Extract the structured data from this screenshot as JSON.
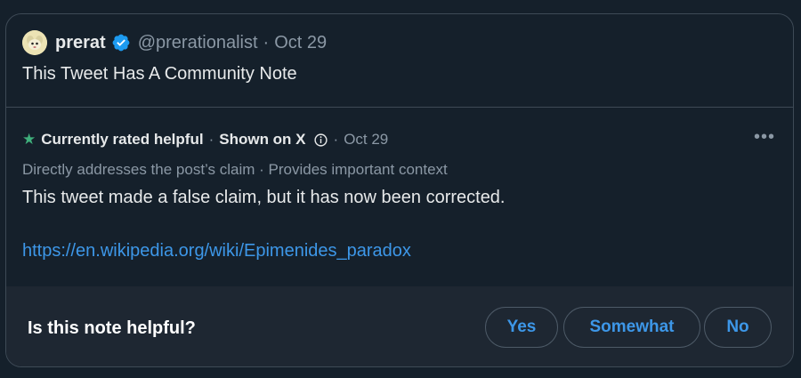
{
  "tweet": {
    "author_name": "prerat",
    "author_handle": "@prerationalist",
    "separator": "·",
    "date": "Oct 29",
    "text": "This Tweet Has A Community Note"
  },
  "note": {
    "status_label": "Currently rated helpful",
    "separator": "·",
    "shown_label": "Shown on X",
    "date": "Oct 29",
    "reasons": "Directly addresses the post’s claim · Provides important context",
    "text": "This tweet made a false claim, but it has now been corrected.",
    "link": "https://en.wikipedia.org/wiki/Epimenides_paradox",
    "more_label": "•••"
  },
  "rating": {
    "question": "Is this note helpful?",
    "options": [
      "Yes",
      "Somewhat",
      "No"
    ]
  },
  "icons": {
    "verified": "verified-badge-icon",
    "star": "star-icon",
    "info": "info-icon",
    "more": "more-options-icon"
  },
  "colors": {
    "background": "#15202b",
    "footer": "#1e2732",
    "accent": "#3d97e8",
    "helpful_green": "#3fb07c",
    "muted": "#8b98a5"
  }
}
